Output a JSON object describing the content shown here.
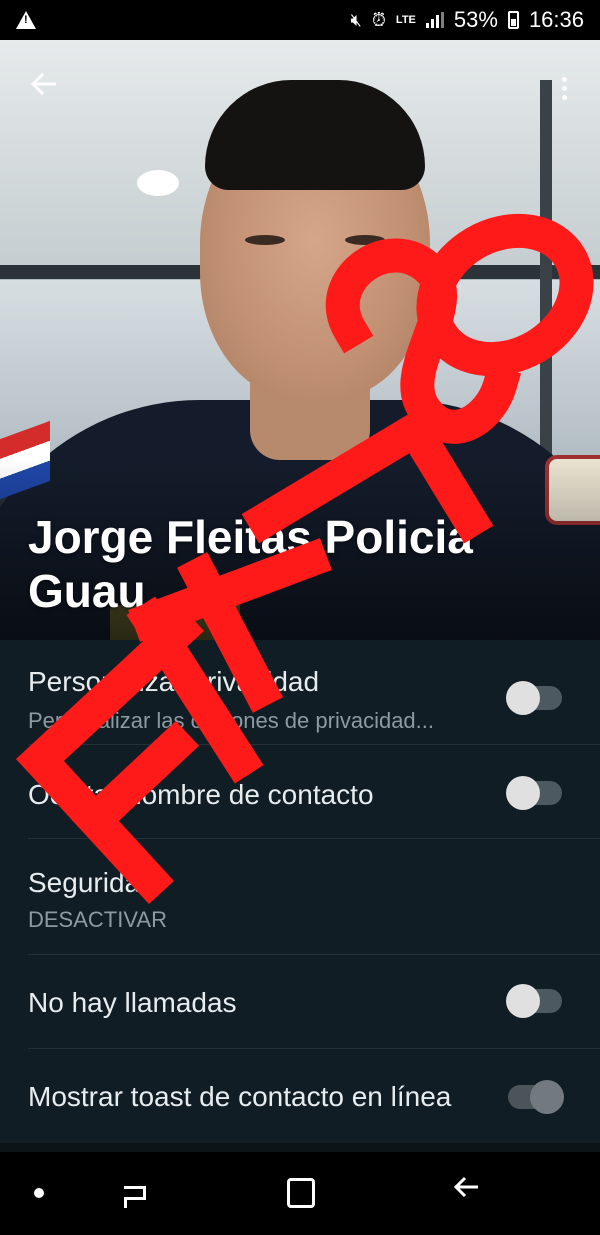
{
  "status_bar": {
    "battery": "53%",
    "time": "16:36",
    "network": "LTE",
    "icons": [
      "warning-icon",
      "mute-icon",
      "alarm-icon",
      "signal-icon",
      "battery-icon"
    ]
  },
  "header": {
    "contact_name": "Jorge Fleitas Policia Guau",
    "back_icon": "arrow-left-icon",
    "menu_icon": "more-vert-icon"
  },
  "settings": {
    "items": [
      {
        "title": "Personalizar privacidad",
        "subtitle": "Personalizar las opciones de privacidad...",
        "toggle": "off"
      },
      {
        "title": "Ocultar nombre de contacto",
        "toggle": "off"
      },
      {
        "title": "Seguridad",
        "subtitle": "DESACTIVAR"
      },
      {
        "title": "No hay llamadas",
        "toggle": "off"
      },
      {
        "title": "Mostrar toast de contacto en línea",
        "toggle": "disabled"
      }
    ]
  },
  "stamp": {
    "text": "FALSO",
    "color": "#ff1a1a"
  },
  "colors": {
    "background": "#101d25",
    "divider": "#243038",
    "subtitle": "#8e9aa1"
  },
  "nav_bar": {
    "icons": [
      "dot-icon",
      "recents-icon",
      "home-icon",
      "back-icon"
    ]
  }
}
